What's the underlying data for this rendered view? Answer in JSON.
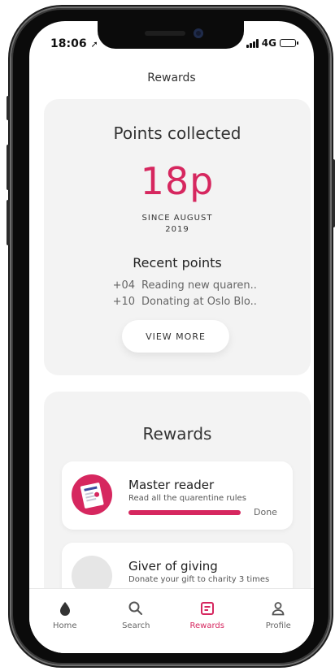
{
  "status_bar": {
    "time": "18:06",
    "network": "4G"
  },
  "header": {
    "title": "Rewards"
  },
  "points_card": {
    "title": "Points collected",
    "value": "18p",
    "since_line1": "SINCE AUGUST",
    "since_line2": "2019",
    "recent_title": "Recent points",
    "recent": [
      {
        "points": "+04",
        "label": "Reading new quaren.."
      },
      {
        "points": "+10",
        "label": "Donating at Oslo Blo.."
      }
    ],
    "view_more_label": "VIEW MORE"
  },
  "rewards_card": {
    "title": "Rewards",
    "items": [
      {
        "name": "Master reader",
        "description": "Read all the quarentine rules",
        "status": "Done",
        "progress": 1.0
      },
      {
        "name": "Giver of giving",
        "description": "Donate your gift to charity 3 times"
      }
    ]
  },
  "tabs": [
    {
      "label": "Home",
      "icon": "drop-icon"
    },
    {
      "label": "Search",
      "icon": "search-icon"
    },
    {
      "label": "Rewards",
      "icon": "rewards-icon"
    },
    {
      "label": "Profile",
      "icon": "profile-icon"
    }
  ],
  "colors": {
    "accent": "#d6275f",
    "card_bg": "#f3f3f3"
  }
}
